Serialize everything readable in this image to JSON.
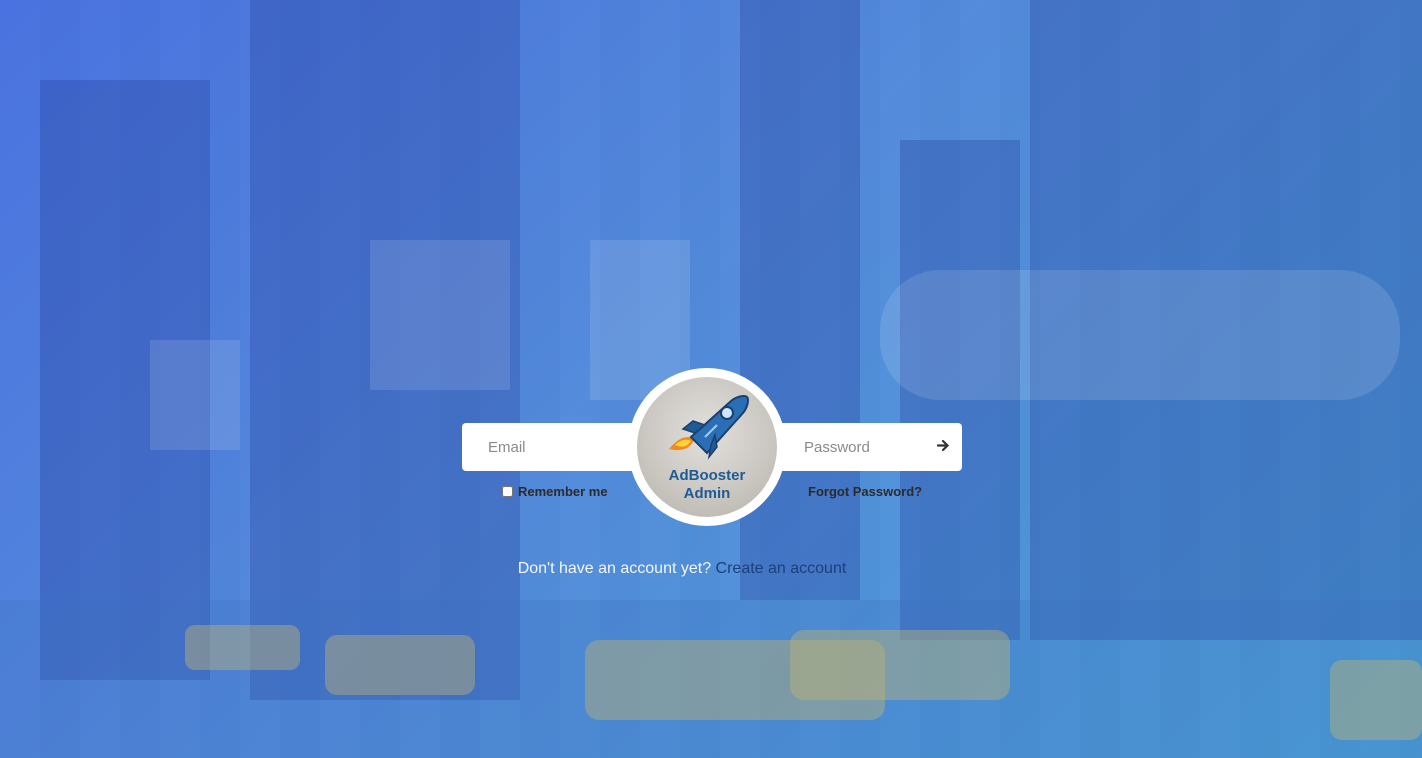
{
  "login": {
    "email_placeholder": "Email",
    "password_placeholder": "Password",
    "remember_label": "Remember me",
    "forgot_label": "Forgot Password?",
    "signup_prompt": "Don't have an account yet?",
    "signup_link": "Create an account"
  },
  "logo": {
    "line1": "AdBooster",
    "line2": "Admin"
  },
  "icons": {
    "submit": "arrow-right-icon",
    "logo": "rocket-icon"
  },
  "colors": {
    "overlay": "#5b84d6",
    "logo_text": "#1f5b95",
    "link": "#1e3f79"
  }
}
